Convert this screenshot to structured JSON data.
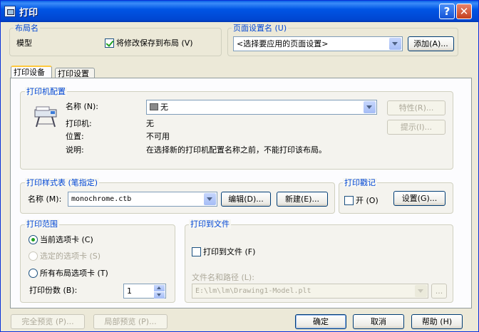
{
  "window": {
    "title": "打印",
    "help": "?",
    "close": "✕"
  },
  "layout_name": {
    "label": "布局名",
    "value": "模型",
    "save_checkbox_label": "将修改保存到布局 (V)",
    "save_checked": true
  },
  "page_setup": {
    "label": "页面设置名 (U)",
    "selected": "<选择要应用的页面设置>",
    "add_button": "添加(A)..."
  },
  "tabs": [
    {
      "label": "打印设备",
      "active": true
    },
    {
      "label": "打印设置",
      "active": false
    }
  ],
  "printer_config": {
    "label": "打印机配置",
    "name_label": "名称 (N):",
    "name_value": "无",
    "properties_button": "特性(R)...",
    "hint_button": "提示(I)...",
    "printer_label": "打印机:",
    "printer_value": "无",
    "location_label": "位置:",
    "location_value": "不可用",
    "description_label": "说明:",
    "description_value": "在选择新的打印机配置名称之前，不能打印该布局。"
  },
  "plot_style": {
    "label": "打印样式表 (笔指定)",
    "name_label": "名称 (M):",
    "name_value": "monochrome.ctb",
    "edit_button": "编辑(D)...",
    "new_button": "新建(E)..."
  },
  "stamp": {
    "label": "打印戳记",
    "on_label": "开 (O)",
    "on_checked": false,
    "settings_button": "设置(G)..."
  },
  "plot_range": {
    "label": "打印范围",
    "options": [
      {
        "label": "当前选项卡 (C)",
        "checked": true,
        "disabled": false
      },
      {
        "label": "选定的选项卡 (S)",
        "checked": false,
        "disabled": true
      },
      {
        "label": "所有布局选项卡 (T)",
        "checked": false,
        "disabled": false
      }
    ],
    "copies_label": "打印份数 (B):",
    "copies_value": "1"
  },
  "plot_to_file": {
    "label": "打印到文件",
    "checkbox_label": "打印到文件 (F)",
    "checked": false,
    "path_label": "文件名和路径 (L):",
    "path_value": "E:\\lm\\lm\\Drawing1-Model.plt",
    "browse_button": "..."
  },
  "footer": {
    "full_preview": "完全预览 (P)...",
    "partial_preview": "局部预览 (P)...",
    "ok": "确定",
    "cancel": "取消",
    "help": "帮助 (H)"
  }
}
